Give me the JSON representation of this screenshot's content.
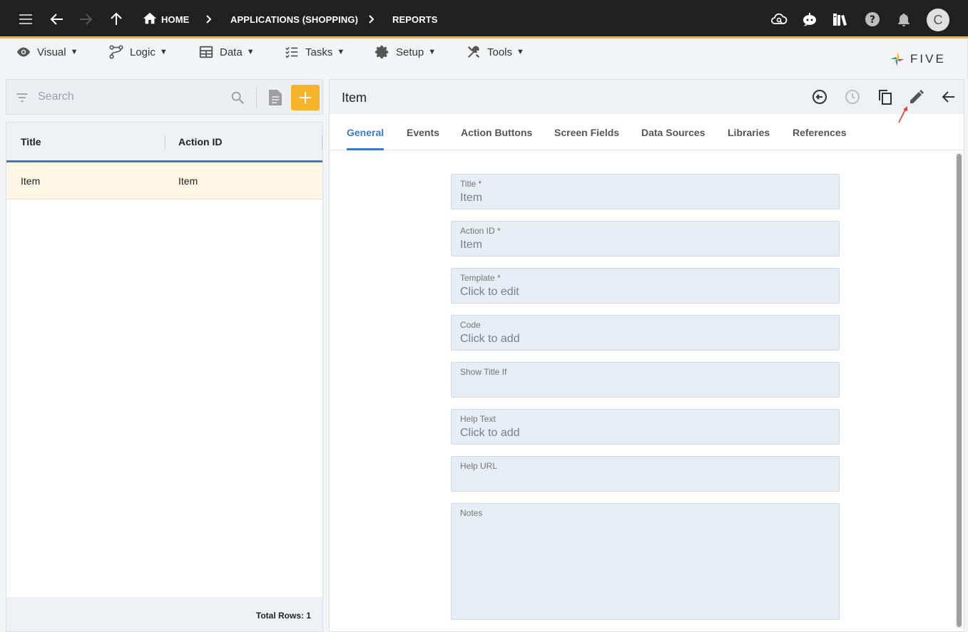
{
  "topbar": {
    "breadcrumbs": [
      {
        "label": "HOME"
      },
      {
        "label": "APPLICATIONS (SHOPPING)"
      },
      {
        "label": "REPORTS"
      }
    ],
    "avatar_initial": "C",
    "icons": [
      "menu-icon",
      "back-icon",
      "forward-icon",
      "up-icon",
      "home-icon",
      "cloud-search-icon",
      "chat-bot-icon",
      "books-icon",
      "help-icon",
      "bell-icon"
    ],
    "accent": "#f6b42a",
    "bg": "#212121"
  },
  "menubar": {
    "items": [
      {
        "label": "Visual",
        "icon": "eye-icon"
      },
      {
        "label": "Logic",
        "icon": "logic-icon"
      },
      {
        "label": "Data",
        "icon": "table-icon"
      },
      {
        "label": "Tasks",
        "icon": "tasks-icon"
      },
      {
        "label": "Setup",
        "icon": "gear-icon"
      },
      {
        "label": "Tools",
        "icon": "tools-icon"
      }
    ],
    "caret": "▼",
    "logo_text": "FIVE"
  },
  "left": {
    "search_placeholder": "Search",
    "columns": [
      "Title",
      "Action ID"
    ],
    "rows": [
      {
        "title": "Item",
        "action_id": "Item"
      }
    ],
    "total_rows": "Total Rows: 1",
    "selected_row_color": "#fef7e6"
  },
  "right": {
    "title": "Item",
    "tabs": [
      "General",
      "Events",
      "Action Buttons",
      "Screen Fields",
      "Data Sources",
      "Libraries",
      "References"
    ],
    "active_tab": "General",
    "fields": [
      {
        "label": "Title *",
        "value": "Item"
      },
      {
        "label": "Action ID *",
        "value": "Item"
      },
      {
        "label": "Template *",
        "value": "Click to edit"
      },
      {
        "label": "Code",
        "value": "Click to add"
      },
      {
        "label": "Show Title If",
        "value": ""
      },
      {
        "label": "Help Text",
        "value": "Click to add"
      },
      {
        "label": "Help URL",
        "value": ""
      },
      {
        "label": "Notes",
        "value": ""
      }
    ],
    "header_icons": [
      "history-back-icon",
      "clock-icon",
      "copy-icon",
      "edit-icon",
      "back-arrow-icon"
    ],
    "accent": "#3d7bc8"
  }
}
